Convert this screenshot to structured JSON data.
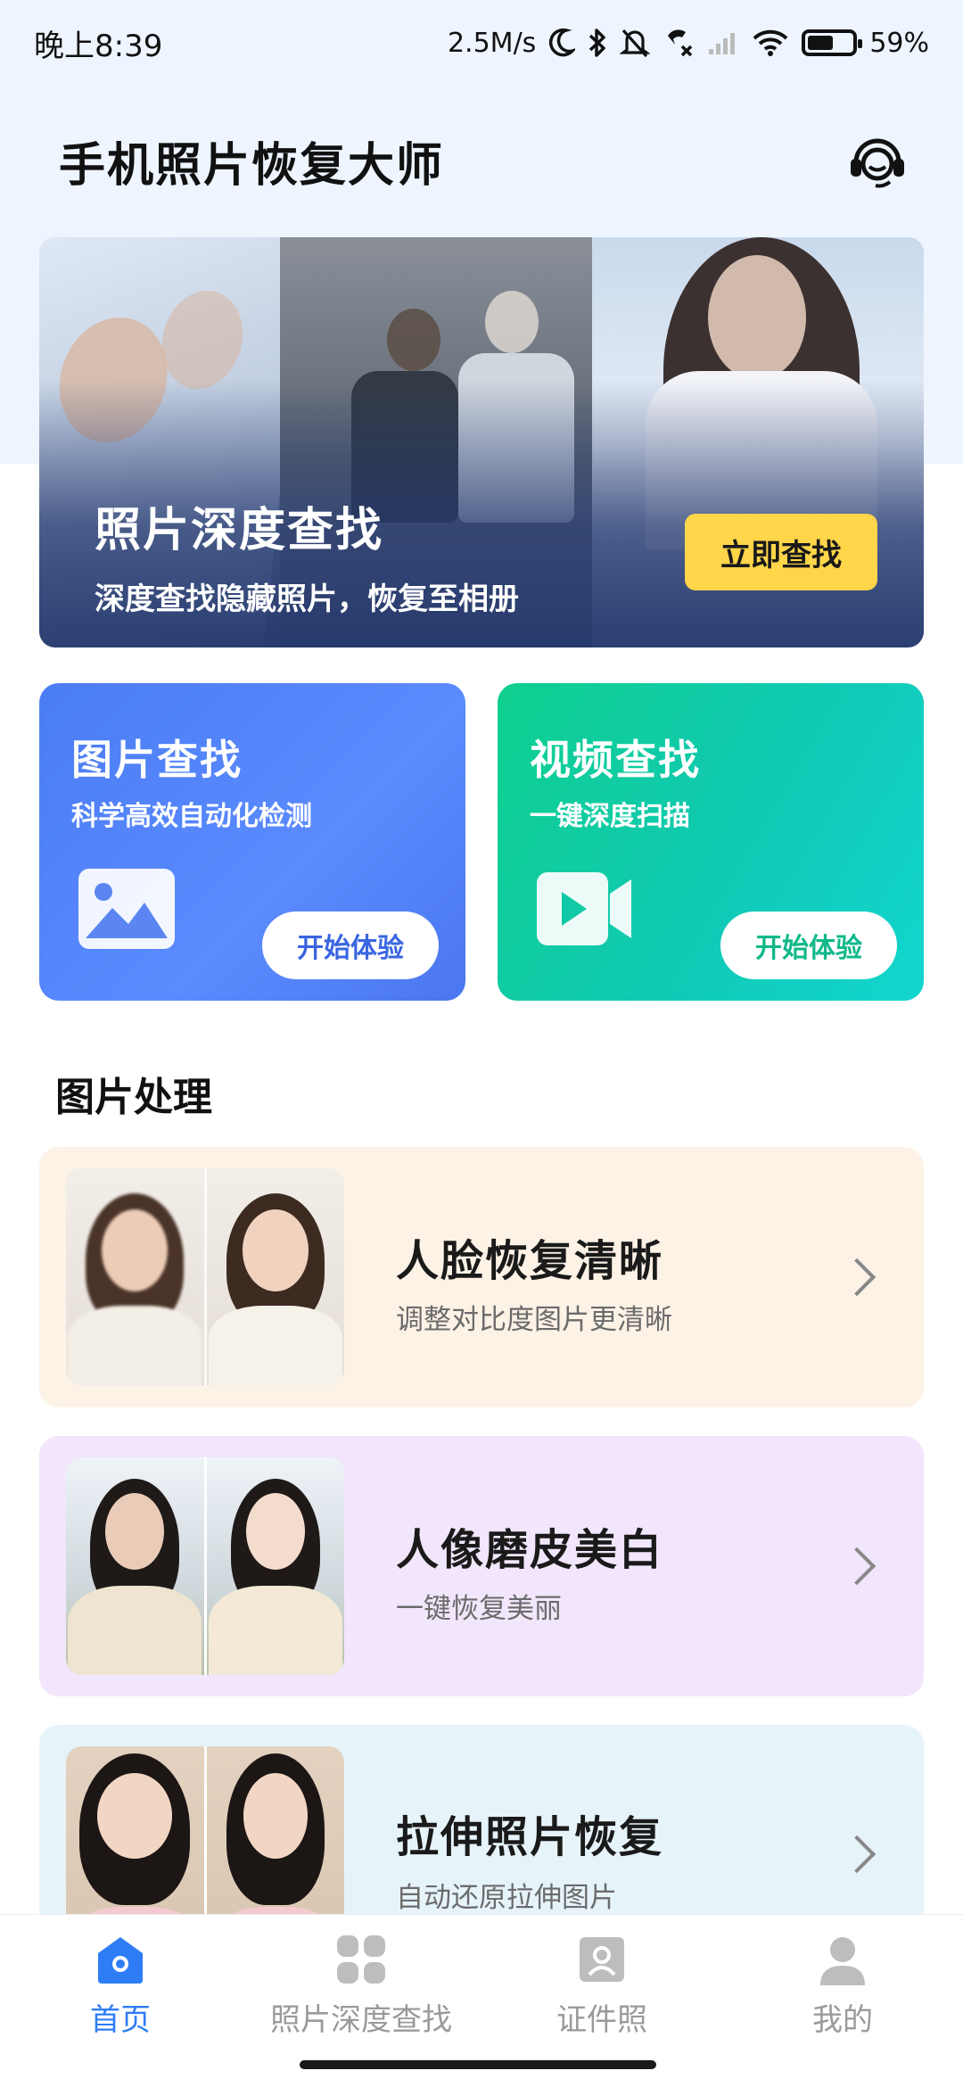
{
  "status_bar": {
    "time": "晚上8:39",
    "network_speed": "2.5M/s",
    "battery_percent": "59%",
    "battery_level": 0.59,
    "icons": [
      "moon-icon",
      "bluetooth-icon",
      "mute-bell-icon",
      "call-off-icon",
      "signal-icon",
      "wifi-icon",
      "battery-icon"
    ]
  },
  "header": {
    "title": "手机照片恢复大师",
    "support_icon": "headset-icon"
  },
  "banner": {
    "title": "照片深度查找",
    "subtitle": "深度查找隐藏照片，恢复至相册",
    "button": "立即查找",
    "button_color": "#ffd54a"
  },
  "features": [
    {
      "title": "图片查找",
      "subtitle": "科学高效自动化检测",
      "button": "开始体验",
      "icon": "image-icon",
      "color": "#4f80f7"
    },
    {
      "title": "视频查找",
      "subtitle": "一键深度扫描",
      "button": "开始体验",
      "icon": "video-camera-icon",
      "color": "#10ccb0"
    }
  ],
  "section": {
    "title": "图片处理"
  },
  "tools": [
    {
      "title": "人脸恢复清晰",
      "subtitle": "调整对比度图片更清晰",
      "background": "#fdf2e6"
    },
    {
      "title": "人像磨皮美白",
      "subtitle": "一键恢复美丽",
      "background": "#f1e6fb"
    },
    {
      "title": "拉伸照片恢复",
      "subtitle": "自动还原拉伸图片",
      "background": "#e6f4fa"
    }
  ],
  "bottom_nav": {
    "active_color": "#2f7df6",
    "items": [
      {
        "label": "首页",
        "icon": "home-icon",
        "active": true
      },
      {
        "label": "照片深度查找",
        "icon": "grid-icon",
        "active": false
      },
      {
        "label": "证件照",
        "icon": "id-photo-icon",
        "active": false
      },
      {
        "label": "我的",
        "icon": "profile-icon",
        "active": false
      }
    ]
  }
}
